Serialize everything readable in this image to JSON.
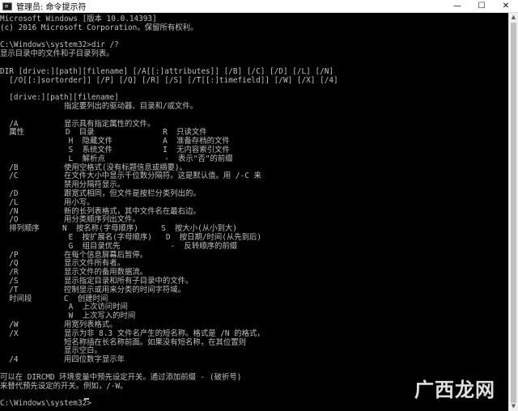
{
  "window": {
    "title": "管理员: 命令提示符",
    "minimize": "—",
    "maximize": "☐",
    "close": "✕"
  },
  "console": {
    "lines": [
      "Microsoft Windows [版本 10.0.14393]",
      "(c) 2016 Microsoft Corporation。保留所有权利。",
      "",
      "C:\\Windows\\system32>dir /?",
      "显示目录中的文件和子目录列表。",
      "",
      "DIR [drive:][path][filename] [/A[[:]attributes]] [/B] [/C] [/D] [/L] [/N]",
      "  [/O[[:]sortorder]] [/P] [/Q] [/R] [/S] [/T[[:]timefield]] [/W] [/X] [/4]",
      "",
      "  [drive:][path][filename]",
      "              指定要列出的驱动器、目录和/或文件。",
      "",
      "  /A          显示具有指定属性的文件。",
      "  属性         D  目录               R  只读文件",
      "               H  隐藏文件           A  准备存档的文件",
      "               S  系统文件           I  无内容索引文件",
      "               L  解析点             -  表示\"否\"的前缀",
      "  /B          使用空格式(没有标题信息或摘要)。",
      "  /C          在文件大小中显示千位数分隔符。这是默认值。用 /-C 来",
      "              禁用分隔符显示。",
      "  /D          跟宽式相同，但文件是按栏分类列出的。",
      "  /L          用小写。",
      "  /N          新的长列表格式，其中文件名在最右边。",
      "  /O          用分类顺序列出文件。",
      "  排列顺序     N  按名称(字母顺序)     S  按大小(从小到大)",
      "               E  按扩展名(字母顺序)   D  按日期/时间(从先到后)",
      "               G  组目录优先           -  反转顺序的前缀",
      "  /P          在每个信息屏幕后暂停。",
      "  /Q          显示文件所有者。",
      "  /R          显示文件的备用数据流。",
      "  /S          显示指定目录和所有子目录中的文件。",
      "  /T          控制显示或用来分类的时间字符域。",
      "  时间段       C  创建时间",
      "               A  上次访问时间",
      "               W  上次写入的时间",
      "  /W          用宽列表格式。",
      "  /X          显示为非 8.3 文件名产生的短名称。格式是 /N 的格式，",
      "              短名称插在长名称前面。如果没有短名称，在其位置则",
      "              显示空白。",
      "  /4          用四位数字显示年",
      "",
      "可以在 DIRCMD 环境变量中预先设定开关。通过添加前缀 - (破折号)",
      "来替代预先设定的开关。例如，/-W。",
      "",
      "C:\\Windows\\system32>"
    ]
  },
  "scrollbar": {
    "up": "▲",
    "down": "▼"
  },
  "watermark": "广西龙网",
  "colors": {
    "console_bg": "#000000",
    "console_text": "#c0c0c0",
    "titlebar_bg": "#ffffff"
  }
}
